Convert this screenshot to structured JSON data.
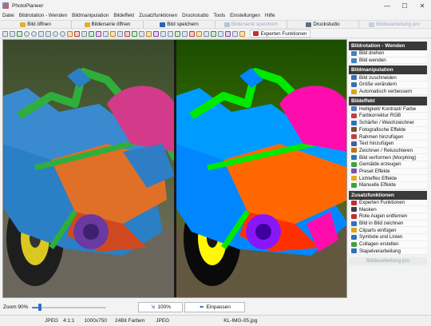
{
  "window": {
    "title": "PhotoPlaneer",
    "controls": [
      "—",
      "☐",
      "✕"
    ]
  },
  "menu": [
    "Datei",
    "Bildrotation - Wenden",
    "Bildmanipulation",
    "Bildeffekt",
    "Zusatzfunktionen",
    "Druckstudio",
    "Tools",
    "Einstellungen",
    "Hilfe"
  ],
  "bigbar": {
    "open": "Bild öffnen",
    "batch": "Bilderserie öffnen",
    "save": "Bild speichern",
    "save_series": "Bilderserie speichern",
    "print": "Druckstudio",
    "batch_process": "Bildbearbeitung pro",
    "expert": "Experten Funktionen"
  },
  "panel": {
    "sections": [
      {
        "title": "Bildrotation - Wenden",
        "items": [
          {
            "label": "Bild drehen",
            "icon": "rotate-icon",
            "color": "#4a7fc0"
          },
          {
            "label": "Bild wenden",
            "icon": "flip-icon",
            "color": "#4a7fc0"
          }
        ]
      },
      {
        "title": "Bildmanipulation",
        "items": [
          {
            "label": "Bild zuschneiden",
            "icon": "crop-icon",
            "color": "#3a6fb0"
          },
          {
            "label": "Größe verändern",
            "icon": "resize-icon",
            "color": "#3a6fb0"
          },
          {
            "label": "Automatisch verbessern",
            "icon": "auto-enhance-icon",
            "color": "#e0a020"
          }
        ]
      },
      {
        "title": "Bildeffekt",
        "items": [
          {
            "label": "Helligkeit/ Kontrast/ Farbe",
            "icon": "brightness-icon",
            "color": "#5080c0"
          },
          {
            "label": "Farbkorrektur RGB",
            "icon": "rgb-icon",
            "color": "#c04040"
          },
          {
            "label": "Schärfer / Weichzeichner",
            "icon": "sharpen-icon",
            "color": "#3070c0"
          },
          {
            "label": "Fotografische Effekte",
            "icon": "photo-effects-icon",
            "color": "#7a5030"
          },
          {
            "label": "Rahmen hinzufügen",
            "icon": "frame-icon",
            "color": "#c04040"
          },
          {
            "label": "Text hinzufügen",
            "icon": "text-icon",
            "color": "#4060a0"
          },
          {
            "label": "Zeichnen / Retuschieren",
            "icon": "brush-icon",
            "color": "#c07020"
          },
          {
            "label": "Bild verformen (Morphing)",
            "icon": "morph-icon",
            "color": "#3070c0"
          },
          {
            "label": "Gemälde erzeugen",
            "icon": "painting-icon",
            "color": "#40a040"
          },
          {
            "label": "Preset Effekte",
            "icon": "preset-icon",
            "color": "#8050b0"
          },
          {
            "label": "Lichteffex Effekte",
            "icon": "light-effects-icon",
            "color": "#e0b020"
          },
          {
            "label": "Manuelle Effekte",
            "icon": "manual-effects-icon",
            "color": "#40a040"
          }
        ]
      },
      {
        "title": "Zusatzfunktionen",
        "items": [
          {
            "label": "Experten Funktionen",
            "icon": "expert-icon",
            "color": "#c03030"
          },
          {
            "label": "Masken",
            "icon": "mask-icon",
            "color": "#404040"
          },
          {
            "label": "Rote Augen entfernen",
            "icon": "red-eye-icon",
            "color": "#c03030"
          },
          {
            "label": "Bild in Bild zeichnen",
            "icon": "picture-in-picture-icon",
            "color": "#3070c0"
          },
          {
            "label": "Cliparts einfügen",
            "icon": "clipart-icon",
            "color": "#e0a020"
          },
          {
            "label": "Symbole und Linien",
            "icon": "symbols-icon",
            "color": "#3070c0"
          },
          {
            "label": "Collagen erstellen",
            "icon": "collage-icon",
            "color": "#40a040"
          },
          {
            "label": "Stapelverarbeitung",
            "icon": "batch-icon",
            "color": "#3070c0"
          }
        ]
      }
    ],
    "footer": "Bildbearbeitung pro"
  },
  "zoom": {
    "label": "Zoom  90%",
    "value": 0.9,
    "btn100": "100%",
    "fit": "Einpassen"
  },
  "status": {
    "format": "JPEG",
    "ratio": "4:1:1",
    "size": "1000x750",
    "depth": "24Bit Farben",
    "type": "JPEG",
    "filename": "KL-IMG-05.jpg"
  }
}
